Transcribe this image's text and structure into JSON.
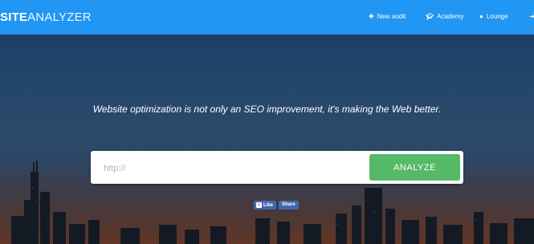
{
  "brand": {
    "bold": "SITE",
    "thin": "ANALYZER"
  },
  "nav": {
    "new_audit": "New audit",
    "academy": "Academy",
    "lounge": "Lounge"
  },
  "hero": {
    "tagline": "Website optimization is not only an SEO improvement, it's making the Web better.",
    "url_placeholder": "http://",
    "analyze_label": "ANALYZE"
  },
  "social": {
    "like": "Like",
    "share": "Share"
  },
  "colors": {
    "topbar": "#2196f3",
    "analyze": "#56b968",
    "facebook": "#4267b2"
  }
}
